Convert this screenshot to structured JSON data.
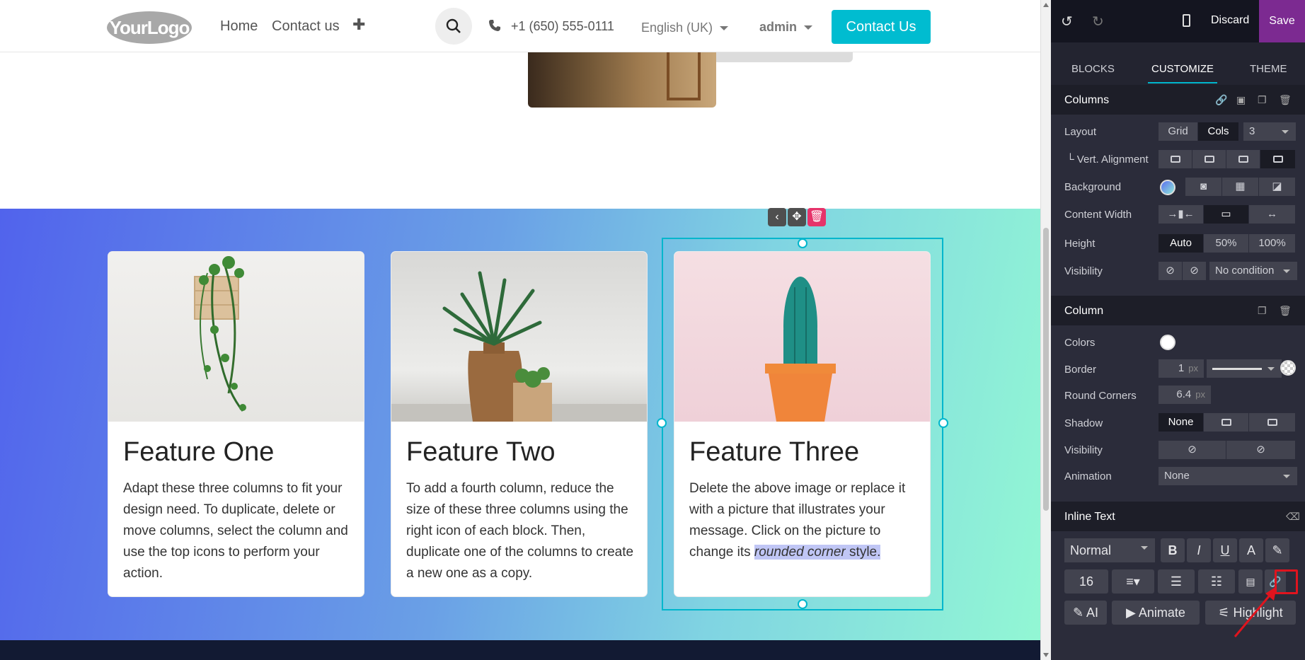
{
  "header": {
    "logo_text": "YourLogo",
    "nav": [
      "Home",
      "Contact us"
    ],
    "plus": "✚",
    "phone": "+1 (650) 555-0111",
    "language": "English (UK)",
    "user": "admin",
    "cta": "Contact Us"
  },
  "features": [
    {
      "title": "Feature One",
      "text": "Adapt these three columns to fit your design need. To duplicate, delete or move columns, select the column and use the top icons to perform your action."
    },
    {
      "title": "Feature Two",
      "text": "To add a fourth column, reduce the size of these three columns using the right icon of each block. Then, duplicate one of the columns to create a new one as a copy."
    },
    {
      "title": "Feature Three",
      "text_before": "Delete the above image or replace it with a picture that illustrates your message. Click on the picture to change its ",
      "text_highlight_italic": "rounded corner",
      "text_highlight_plain": " style."
    }
  ],
  "editor": {
    "discard": "Discard",
    "save": "Save",
    "tabs": [
      "BLOCKS",
      "CUSTOMIZE",
      "THEME"
    ],
    "active_tab": "CUSTOMIZE",
    "columns": {
      "title": "Columns",
      "layout_label": "Layout",
      "layout_options": [
        "Grid",
        "Cols"
      ],
      "layout_active": "Cols",
      "cols_count": "3",
      "vert_label": "└ Vert. Alignment",
      "background_label": "Background",
      "content_width_label": "Content Width",
      "height_label": "Height",
      "height_options": [
        "Auto",
        "50%",
        "100%"
      ],
      "height_active": "Auto",
      "visibility_label": "Visibility",
      "visibility_value": "No condition"
    },
    "column": {
      "title": "Column",
      "colors_label": "Colors",
      "border_label": "Border",
      "border_value": "1",
      "unit": "px",
      "round_label": "Round Corners",
      "round_value": "6.4",
      "shadow_label": "Shadow",
      "shadow_active": "None",
      "visibility_label": "Visibility",
      "animation_label": "Animation",
      "animation_value": "None"
    },
    "inline_text": {
      "title": "Inline Text",
      "style": "Normal",
      "bold": "B",
      "italic": "I",
      "underline": "U",
      "font_size": "16",
      "ai": "AI",
      "animate": "Animate",
      "highlight": "Highlight"
    },
    "accent_color": "#00b6cc",
    "save_color": "#7c2a91"
  }
}
